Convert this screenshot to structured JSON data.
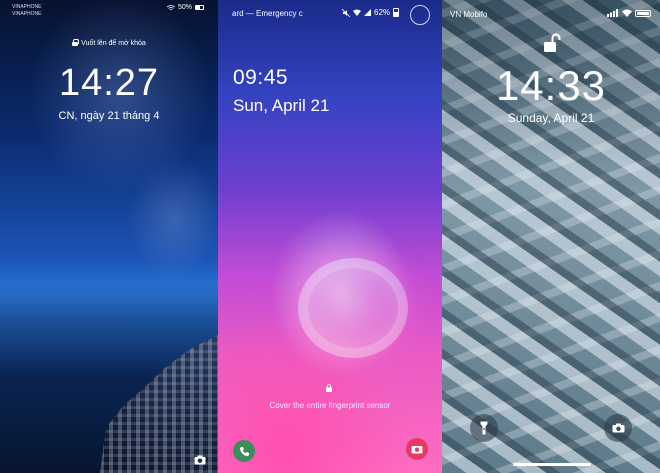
{
  "panel1": {
    "carriers": [
      "VINAPHONE",
      "VINAPHONE"
    ],
    "battery": "50%",
    "unlock_hint": "Vuốt lên để mở khóa",
    "time": "14:27",
    "date": "CN, ngày 21 tháng 4",
    "icons": {
      "lock": "lock-icon",
      "camera": "camera-icon",
      "wifi": "wifi-icon",
      "battery": "battery-icon"
    }
  },
  "panel2": {
    "status_text": "ard — Emergency c",
    "battery": "62%",
    "time": "09:45",
    "date": "Sun, April 21",
    "fingerprint_hint": "Cover the entire fingerprint sensor",
    "accent_phone": "#3d8c5a",
    "accent_camera": "#e63a66",
    "icons": {
      "mute": "mute-icon",
      "wifi": "wifi-icon",
      "signal": "signal-icon",
      "lock": "lock-icon",
      "phone": "phone-icon",
      "camera": "camera-icon"
    }
  },
  "panel3": {
    "carrier": "VN Mobifo",
    "time": "14:33",
    "date": "Sunday, April 21",
    "icons": {
      "padlock": "unlocked-padlock-icon",
      "flashlight": "flashlight-icon",
      "camera": "camera-icon",
      "signal": "signal-icon",
      "wifi": "wifi-icon",
      "battery": "battery-icon"
    }
  }
}
